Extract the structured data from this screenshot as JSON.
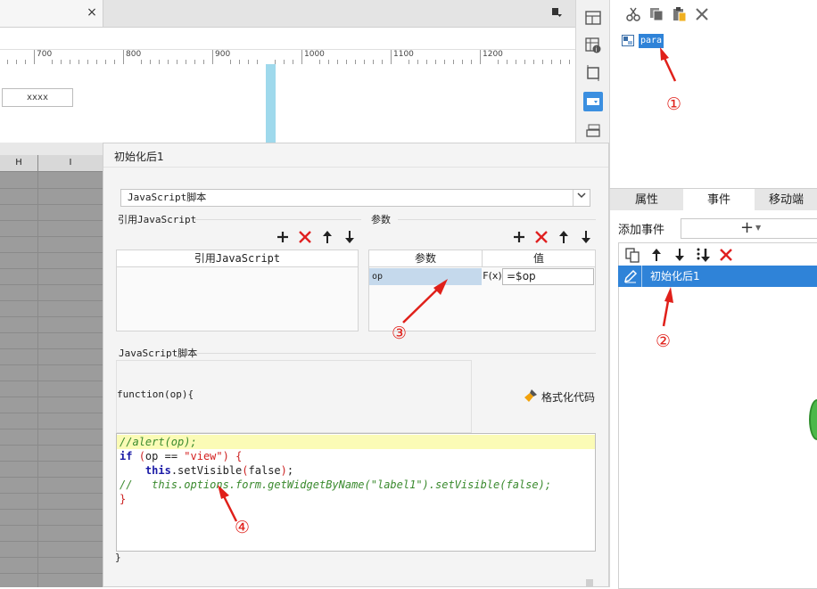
{
  "canvas": {
    "tab_close": "×",
    "tab_menu": "▾",
    "ruler_ticks": [
      "700",
      "800",
      "900",
      "1000",
      "1100",
      "1200"
    ],
    "widget_text": "xxxx",
    "columns": [
      "H",
      "I"
    ]
  },
  "tree": {
    "node_label": "para"
  },
  "right_tabs": [
    "属性",
    "事件",
    "移动端"
  ],
  "events": {
    "add_label": "添加事件",
    "add_symbol": "+",
    "items": [
      "初始化后1"
    ]
  },
  "dialog": {
    "title": "初始化后1",
    "script_type": "JavaScript脚本",
    "ref_section_label": "引用JavaScript",
    "ref_table_header": "引用JavaScript",
    "param_section_label": "参数",
    "param_headers": [
      "参数",
      "值"
    ],
    "param_rows": [
      {
        "name": "op",
        "fx": "F(x)",
        "value": "=$op"
      }
    ],
    "script_section_label": "JavaScript脚本",
    "function_head": "function(op){",
    "format_label": "格式化代码",
    "code_lines": [
      "//alert(op);",
      "if (op == \"view\") {",
      "    this.setVisible(false);",
      "//   this.options.form.getWidgetByName(\"label1\").setVisible(false);",
      "}"
    ],
    "function_close": "}"
  },
  "annotations": [
    "①",
    "②",
    "③",
    "④"
  ],
  "colors": {
    "selection_blue": "#2f83d8",
    "guide_cyan": "#9fd9ec",
    "annotation_red": "#e0201a",
    "code_highlight": "#fbfbb6"
  },
  "icons": [
    "cut-icon",
    "copy-icon",
    "paste-icon",
    "delete-icon",
    "add-icon",
    "remove-icon",
    "move-up-icon",
    "move-down-icon",
    "format-brush-icon",
    "edit-pencil-icon",
    "move-bottom-icon"
  ]
}
